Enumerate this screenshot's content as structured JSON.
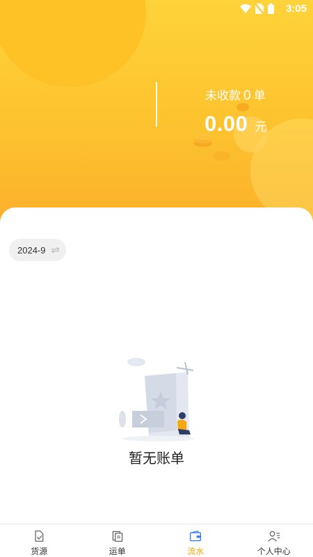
{
  "status_bar": {
    "time": "3:05"
  },
  "summary": {
    "uncollected_label": "未收款",
    "uncollected_count": "0",
    "uncollected_unit": "单",
    "amount": "0.00",
    "amount_unit": "元"
  },
  "filter": {
    "month": "2024-9",
    "swap_icon": "⇌"
  },
  "empty_state": {
    "text": "暂无账单"
  },
  "tabs": [
    {
      "label": "货源",
      "icon": "document-check-icon",
      "active": false
    },
    {
      "label": "运单",
      "icon": "documents-icon",
      "active": false
    },
    {
      "label": "流水",
      "icon": "wallet-icon",
      "active": true
    },
    {
      "label": "个人中心",
      "icon": "user-list-icon",
      "active": false
    }
  ],
  "colors": {
    "accent": "#F5A70C",
    "header_top": "#FFD33A",
    "header_bottom": "#FBB12B",
    "tab_active_icon": "#2F7BF5"
  }
}
